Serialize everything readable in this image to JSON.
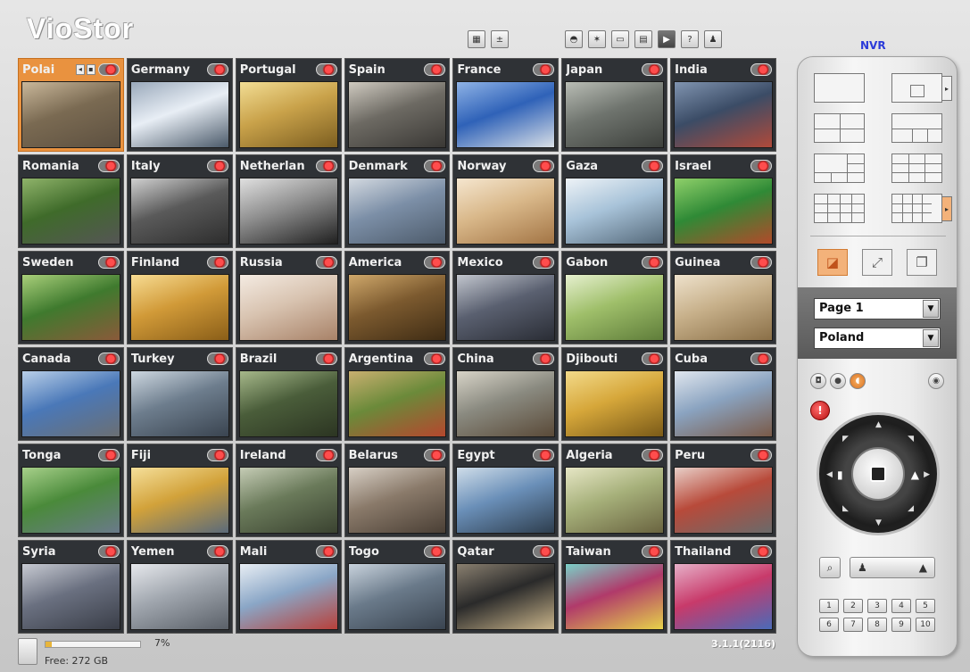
{
  "app": {
    "logo": "VioStor",
    "brand": "NVR",
    "version": "3.1.1(2116)"
  },
  "toolbar": {
    "left": [
      {
        "name": "multi-view-icon",
        "glyph": "▦"
      },
      {
        "name": "sequence-icon",
        "glyph": "±"
      }
    ],
    "right": [
      {
        "name": "monitor-icon",
        "glyph": "◓"
      },
      {
        "name": "camera-settings-icon",
        "glyph": "✶"
      },
      {
        "name": "recording-icon",
        "glyph": "▭"
      },
      {
        "name": "system-icon",
        "glyph": "▤"
      },
      {
        "name": "playback-icon",
        "glyph": "▶"
      },
      {
        "name": "help-icon",
        "glyph": "?"
      },
      {
        "name": "user-icon",
        "glyph": "♟"
      }
    ]
  },
  "cameras": [
    {
      "name": "Polai",
      "active": true,
      "colors": [
        "#7a6a52",
        "#c9b79a",
        "#5d5040"
      ]
    },
    {
      "name": "Germany",
      "colors": [
        "#e8eef5",
        "#9aa9bb",
        "#4b5a6a"
      ]
    },
    {
      "name": "Portugal",
      "colors": [
        "#c9a24a",
        "#f2dd94",
        "#7c5e20"
      ]
    },
    {
      "name": "Spain",
      "colors": [
        "#6d6a63",
        "#cfcac0",
        "#3a3835"
      ]
    },
    {
      "name": "France",
      "colors": [
        "#2f62b8",
        "#8fb3e6",
        "#d9dfe6"
      ]
    },
    {
      "name": "Japan",
      "colors": [
        "#6f746e",
        "#b9bdb5",
        "#3d403c"
      ]
    },
    {
      "name": "India",
      "colors": [
        "#3b4c66",
        "#8094b0",
        "#b04a3a"
      ]
    },
    {
      "name": "Romania",
      "colors": [
        "#3f6b2a",
        "#8fb36a",
        "#555"
      ]
    },
    {
      "name": "Italy",
      "colors": [
        "#5a5a5a",
        "#d0d0d0",
        "#2d2d2d"
      ]
    },
    {
      "name": "Netherlan",
      "colors": [
        "#8e8e8e",
        "#e0e0e0",
        "#202020"
      ]
    },
    {
      "name": "Denmark",
      "colors": [
        "#7c8fa7",
        "#d3d9e0",
        "#4d5b6b"
      ]
    },
    {
      "name": "Norway",
      "colors": [
        "#d9b88a",
        "#f5e6cf",
        "#a37545"
      ]
    },
    {
      "name": "Gaza",
      "colors": [
        "#a8c3d9",
        "#eef3f7",
        "#55697a"
      ]
    },
    {
      "name": "Israel",
      "colors": [
        "#2f8a36",
        "#8fd06a",
        "#b24a2a"
      ]
    },
    {
      "name": "Sweden",
      "colors": [
        "#3f7a2e",
        "#a9cf7a",
        "#8a5a3a"
      ]
    },
    {
      "name": "Finland",
      "colors": [
        "#d19a38",
        "#f7dc93",
        "#8a5e18"
      ]
    },
    {
      "name": "Russia",
      "colors": [
        "#d8c3b0",
        "#f4ebe2",
        "#a88268"
      ]
    },
    {
      "name": "America",
      "colors": [
        "#7c5a2f",
        "#cfa86b",
        "#3f2c14"
      ]
    },
    {
      "name": "Mexico",
      "colors": [
        "#5a6070",
        "#c2c6ce",
        "#2a2d35"
      ]
    },
    {
      "name": "Gabon",
      "colors": [
        "#9fbf6a",
        "#e6f0cf",
        "#5f7d3a"
      ]
    },
    {
      "name": "Guinea",
      "colors": [
        "#c7b08a",
        "#eee2cc",
        "#8a6f47"
      ]
    },
    {
      "name": "Canada",
      "colors": [
        "#4a78b8",
        "#b9cfe8",
        "#6b6f73"
      ]
    },
    {
      "name": "Turkey",
      "colors": [
        "#6d7d8d",
        "#cdd7e0",
        "#3a4450"
      ]
    },
    {
      "name": "Brazil",
      "colors": [
        "#4a5d3a",
        "#a6b88a",
        "#2c3522"
      ]
    },
    {
      "name": "Argentina",
      "colors": [
        "#6b8a3a",
        "#c9b070",
        "#b5472e"
      ]
    },
    {
      "name": "China",
      "colors": [
        "#8a8a80",
        "#d8d4c8",
        "#5a4a38"
      ]
    },
    {
      "name": "Djibouti",
      "colors": [
        "#d6a73a",
        "#f3da8a",
        "#7a5a18"
      ]
    },
    {
      "name": "Cuba",
      "colors": [
        "#8aa3c0",
        "#e0e6ee",
        "#7a5a48"
      ]
    },
    {
      "name": "Tonga",
      "colors": [
        "#4a8a3a",
        "#a7d08a",
        "#6a7a8a"
      ]
    },
    {
      "name": "Fiji",
      "colors": [
        "#d2a23a",
        "#f5df9a",
        "#5a6a7a"
      ]
    },
    {
      "name": "Ireland",
      "colors": [
        "#6a7a5a",
        "#c5ccb5",
        "#3a4230"
      ]
    },
    {
      "name": "Belarus",
      "colors": [
        "#8a7a6a",
        "#d7cfc5",
        "#4a3f35"
      ]
    },
    {
      "name": "Egypt",
      "colors": [
        "#6a8fb8",
        "#cfdde9",
        "#2e3e4e"
      ]
    },
    {
      "name": "Algeria",
      "colors": [
        "#a6b07a",
        "#e6e6c5",
        "#6a6440"
      ]
    },
    {
      "name": "Peru",
      "colors": [
        "#b84a3a",
        "#e8cfc8",
        "#6a6a6a"
      ]
    },
    {
      "name": "Syria",
      "colors": [
        "#6a7080",
        "#c7cad2",
        "#3a3e48"
      ]
    },
    {
      "name": "Yemen",
      "colors": [
        "#a0a6ae",
        "#e6e8ec",
        "#5a6068"
      ]
    },
    {
      "name": "Mali",
      "colors": [
        "#8aa6c6",
        "#e8eef4",
        "#b8403a"
      ]
    },
    {
      "name": "Togo",
      "colors": [
        "#6a7a8a",
        "#c8d2dc",
        "#3a4450"
      ]
    },
    {
      "name": "Qatar",
      "colors": [
        "#2a2a2a",
        "#8a8070",
        "#c9b48a"
      ]
    },
    {
      "name": "Taiwan",
      "colors": [
        "#b03a6a",
        "#7ad0c8",
        "#e6d24a"
      ]
    },
    {
      "name": "Thailand",
      "colors": [
        "#c83a6a",
        "#e6b0c8",
        "#4a6ab8"
      ]
    }
  ],
  "status": {
    "disk_percent": 7,
    "disk_percent_label": "7%",
    "free_label": "Free: 272 GB"
  },
  "panel": {
    "page_select": "Page 1",
    "group_select": "Poland",
    "numpad": [
      "1",
      "2",
      "3",
      "4",
      "5",
      "6",
      "7",
      "8",
      "9",
      "10"
    ]
  }
}
